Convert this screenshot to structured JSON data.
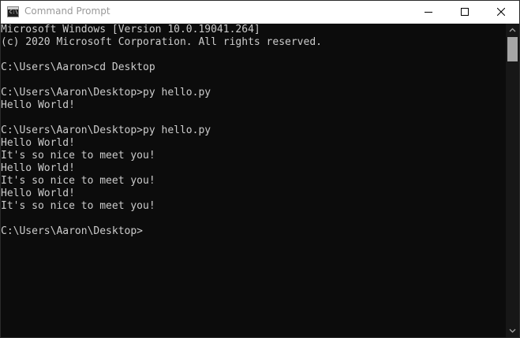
{
  "window": {
    "title": "Command Prompt",
    "icons": {
      "app": "cmd-icon",
      "minimize": "minimize-icon",
      "maximize": "maximize-icon",
      "close": "close-icon"
    }
  },
  "console": {
    "lines": [
      "Microsoft Windows [Version 10.0.19041.264]",
      "(c) 2020 Microsoft Corporation. All rights reserved.",
      "",
      "C:\\Users\\Aaron>cd Desktop",
      "",
      "C:\\Users\\Aaron\\Desktop>py hello.py",
      "Hello World!",
      "",
      "C:\\Users\\Aaron\\Desktop>py hello.py",
      "Hello World!",
      "It's so nice to meet you!",
      "Hello World!",
      "It's so nice to meet you!",
      "Hello World!",
      "It's so nice to meet you!",
      "",
      "C:\\Users\\Aaron\\Desktop>"
    ]
  },
  "colors": {
    "background": "#0c0c0c",
    "text": "#cccccc",
    "titlebar": "#ffffff",
    "title_text": "#999999",
    "scroll_thumb": "#a6a6a6"
  }
}
